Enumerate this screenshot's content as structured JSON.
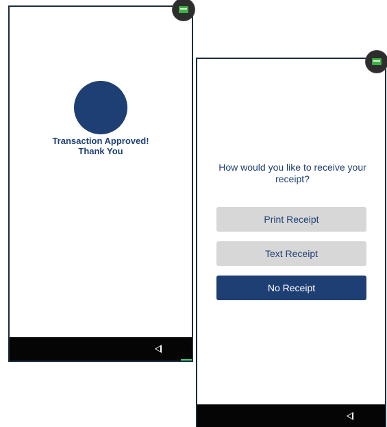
{
  "left_screen": {
    "message_line1": "Transaction Approved!",
    "message_line2": "Thank You"
  },
  "right_screen": {
    "question": "How would you like to receive your receipt?",
    "buttons": [
      {
        "label": "Print Receipt"
      },
      {
        "label": "Text Receipt"
      },
      {
        "label": "No Receipt"
      }
    ]
  },
  "icons": {
    "status_badge": "screen-status-icon",
    "nav_back": "back-triangle-icon"
  },
  "colors": {
    "brand_navy": "#1e3f73",
    "button_gray": "#d7d7d7",
    "nav_bar": "#050505",
    "status_green": "#3cb043"
  }
}
